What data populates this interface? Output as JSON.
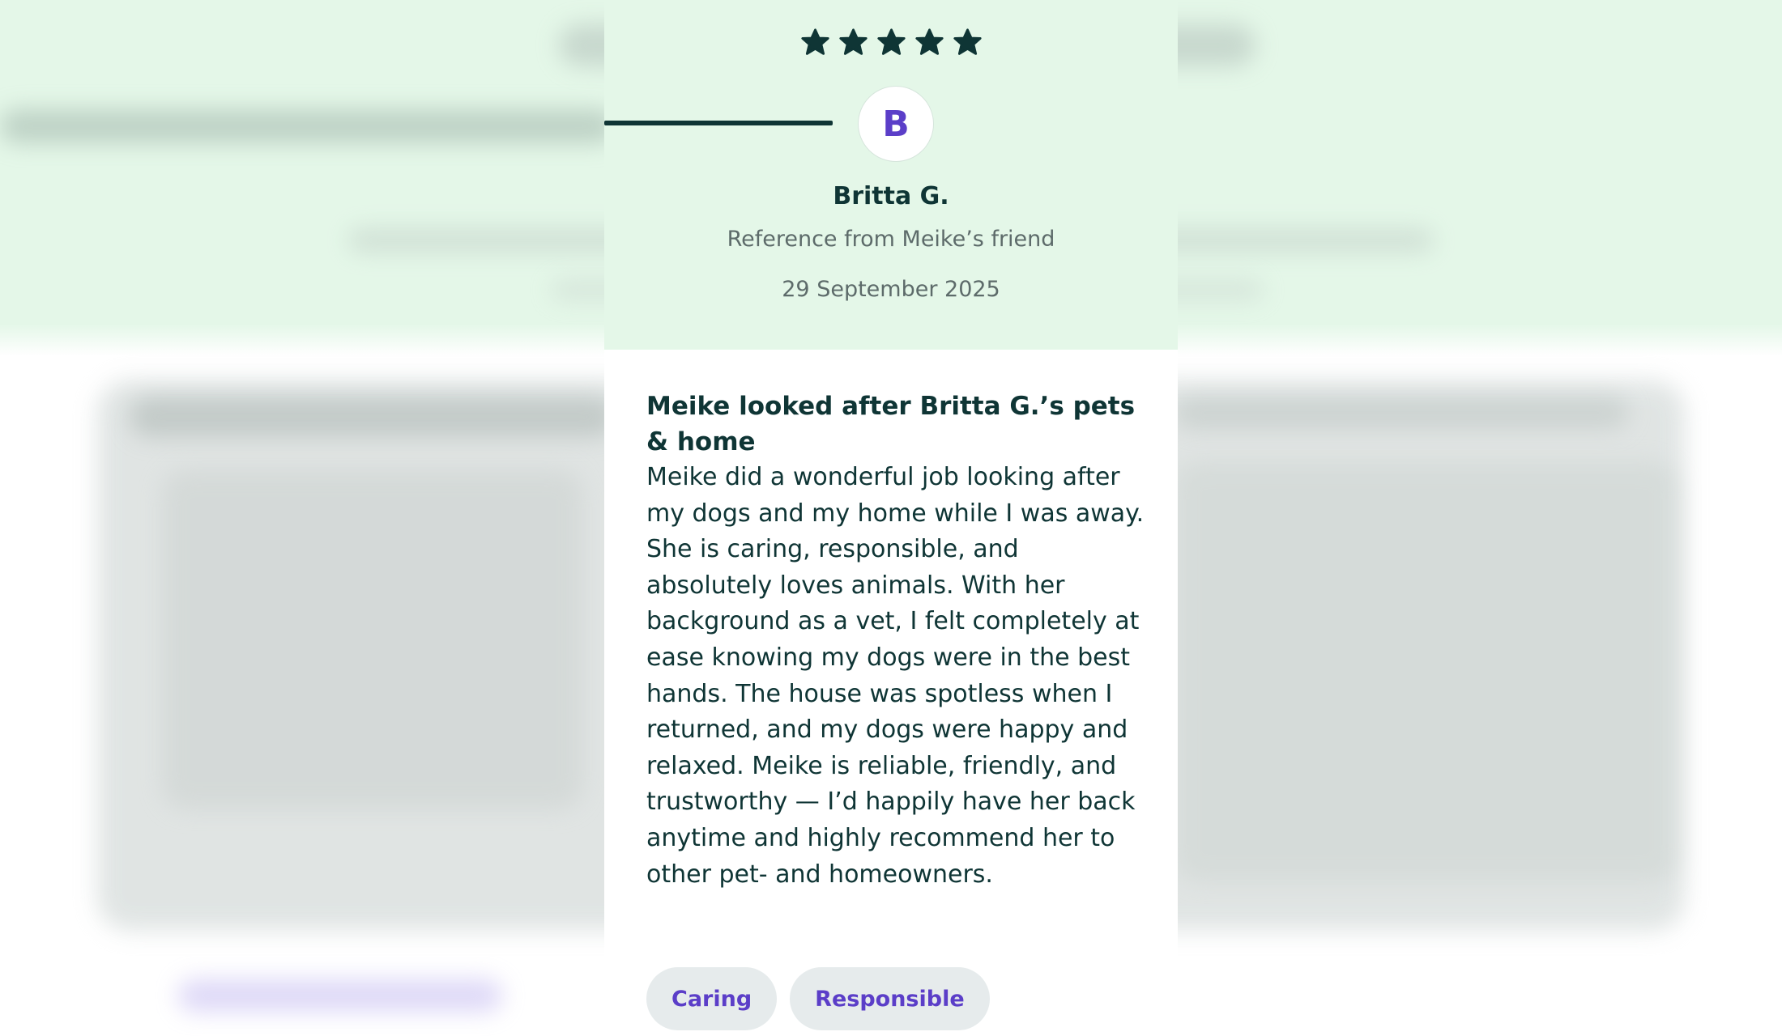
{
  "review": {
    "rating": 5,
    "rating_max": 5,
    "avatar_initial": "B",
    "reviewer_name": "Britta G.",
    "relation": "Reference from Meike’s friend",
    "date": "29 September 2025",
    "title": "Meike looked after Britta G.’s pets & home",
    "body": "Meike did a wonderful job looking after my dogs and my home while I was away. She is caring, responsible, and absolutely loves animals. With her background as a vet, I felt completely at ease knowing my dogs were in the best hands. The house was spotless when I returned, and my dogs were happy and relaxed. Meike is reliable, friendly, and trustworthy — I’d happily have her back anytime and highly recommend her to other pet- and homeowners.",
    "tags": [
      "Caring",
      "Responsible"
    ]
  },
  "icons": {
    "star": "star-icon"
  },
  "colors": {
    "header_bg": "#e4f7e8",
    "text_dark": "#0f3535",
    "text_muted": "#5d6b6a",
    "accent_purple": "#5b3ec8",
    "tag_bg": "#e6ebec"
  }
}
